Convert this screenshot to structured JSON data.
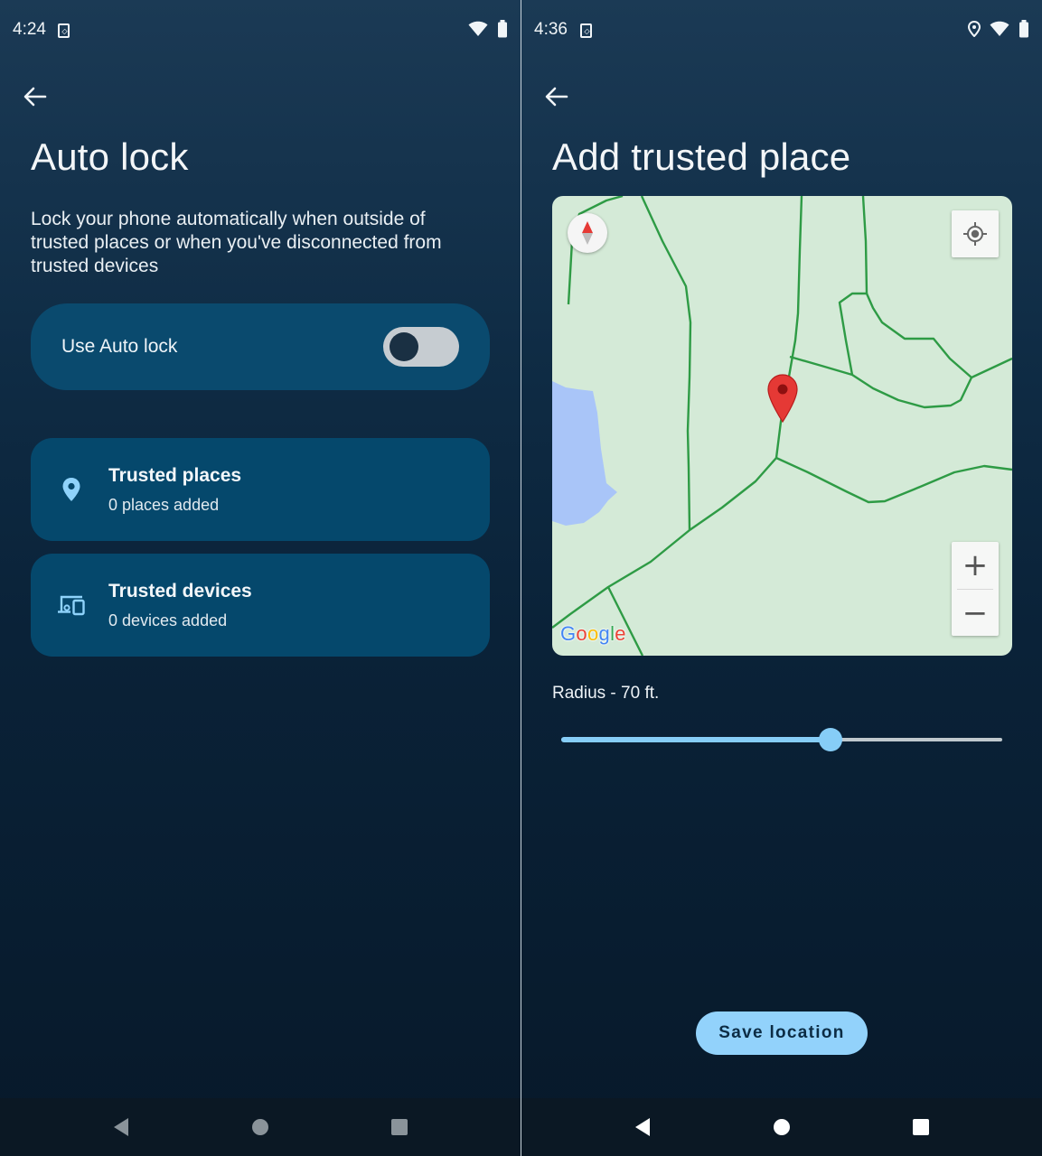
{
  "left_screen": {
    "status": {
      "time": "4:24"
    },
    "title": "Auto lock",
    "description": "Lock your phone automatically when outside of trusted places or when you've disconnected from trusted devices",
    "toggle": {
      "label": "Use Auto lock",
      "state": "off"
    },
    "items": [
      {
        "icon": "location-pin-icon",
        "title": "Trusted places",
        "subtitle": "0 places added"
      },
      {
        "icon": "devices-icon",
        "title": "Trusted devices",
        "subtitle": "0 devices added"
      }
    ]
  },
  "right_screen": {
    "status": {
      "time": "4:36"
    },
    "title": "Add trusted place",
    "map": {
      "logo": [
        "G",
        "o",
        "o",
        "g",
        "l",
        "e"
      ],
      "zoom_in": "+",
      "zoom_out": "−"
    },
    "radius_label": "Radius - 70 ft.",
    "radius_slider_fraction": 0.61,
    "save_button": "Save location"
  },
  "colors": {
    "accent": "#86cdf7",
    "card": "#05486c",
    "pin": "#e53935",
    "road": "#2e9b45",
    "water": "#a9c5f8",
    "map_land": "#d4ead7"
  }
}
